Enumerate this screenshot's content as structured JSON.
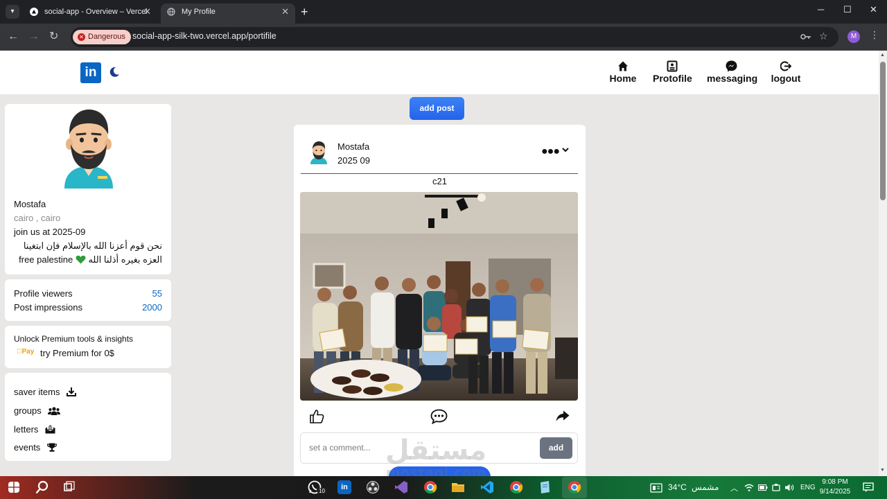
{
  "browser": {
    "tabs": [
      {
        "title": "social-app - Overview – Vercel",
        "active": false
      },
      {
        "title": "My Profile",
        "active": true
      }
    ],
    "security_chip": "Dangerous",
    "url": "social-app-silk-two.vercel.app/portifile",
    "profile_initial": "M"
  },
  "app": {
    "logo_text": "in",
    "nav": [
      {
        "label": "Home",
        "icon": "home-icon"
      },
      {
        "label": "Protofile",
        "icon": "profile-card-icon"
      },
      {
        "label": "messaging",
        "icon": "messenger-icon"
      },
      {
        "label": "logout",
        "icon": "logout-icon"
      }
    ]
  },
  "profile": {
    "name": "Mostafa",
    "location": "cairo , cairo",
    "joined": "join us at 2025-09",
    "bio_line1": "نحن قوم أعزنا الله بالإسلام فإن ابتغينا",
    "bio_line2_ar": "العزه بغيره أذلنا الله",
    "bio_line2_en": "free palestine"
  },
  "stats": [
    {
      "label": "Profile viewers",
      "value": "55"
    },
    {
      "label": "Post impressions",
      "value": "2000"
    }
  ],
  "premium": {
    "title": "Unlock Premium tools & insights",
    "pay_logo": "Pay",
    "cta": "try Premium for 0$"
  },
  "links": [
    {
      "label": "saver items",
      "icon": "download-icon"
    },
    {
      "label": "groups",
      "icon": "users-icon"
    },
    {
      "label": "letters",
      "icon": "envelope-open-icon"
    },
    {
      "label": "events",
      "icon": "trophy-icon"
    }
  ],
  "feed": {
    "add_post_label": "add post",
    "post": {
      "author": "Mostafa",
      "date": "2025 09",
      "text": "c21",
      "comment_placeholder": "set a comment...",
      "comment_add_label": "add"
    }
  },
  "watermark": {
    "arabic": "مستقل",
    "latin": "mostaql.com"
  },
  "taskbar": {
    "whatsapp_badge": "10",
    "weather": "34°C",
    "weather_desc": "مشمس",
    "language": "ENG",
    "time": "9:08 PM",
    "date": "9/14/2025"
  },
  "colors": {
    "accent": "#0a66c2",
    "button": "#2563eb",
    "page_bg": "#e9e7e6",
    "danger": "#c5221f"
  }
}
